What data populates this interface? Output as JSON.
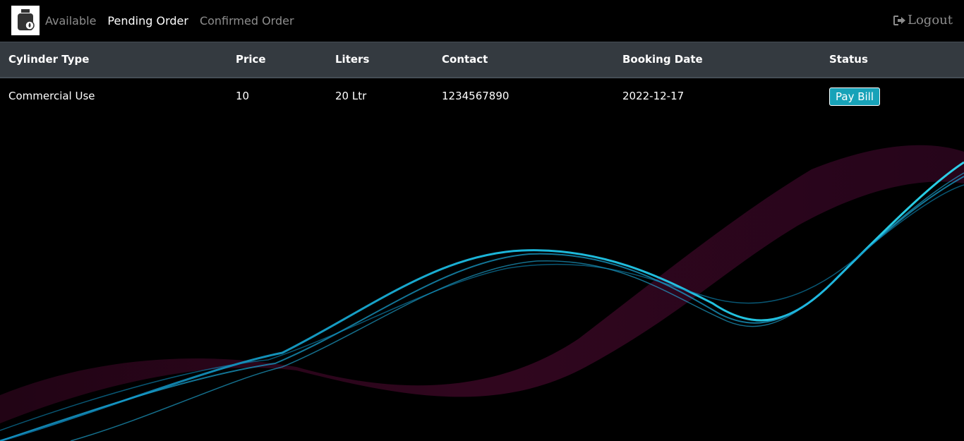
{
  "nav": {
    "brand_icon": "gas-cylinder-logo",
    "links": [
      {
        "label": "Available"
      },
      {
        "label": "Pending Order"
      },
      {
        "label": "Confirmed Order"
      }
    ],
    "logout_label": "Logout",
    "logout_icon": "sign-out-icon"
  },
  "table": {
    "headers": [
      "Cylinder Type",
      "Price",
      "Liters",
      "Contact",
      "Booking Date",
      "Status"
    ],
    "rows": [
      {
        "cylinder_type": "Commercial Use",
        "price": "10",
        "liters": "20 Ltr",
        "contact": "1234567890",
        "booking_date": "2022-12-17",
        "action_label": "Pay Bill"
      }
    ]
  },
  "colors": {
    "header_bg": "#343a40",
    "button": "#17a2b8",
    "wave_cyan": "#1ec8f0",
    "wave_magenta": "#b0156e"
  }
}
